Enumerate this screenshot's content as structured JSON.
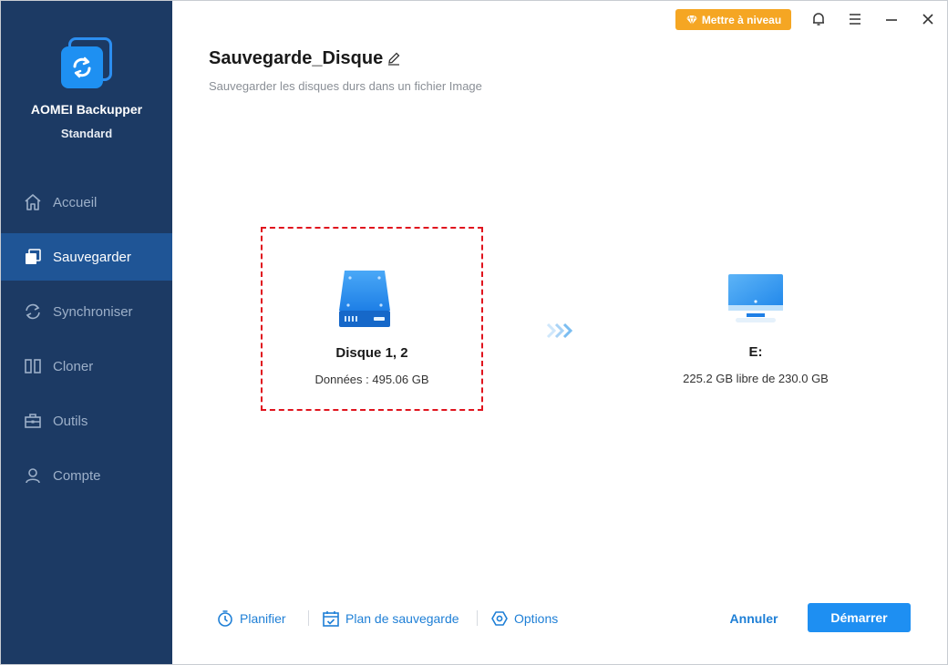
{
  "app": {
    "name": "AOMEI Backupper",
    "edition": "Standard"
  },
  "sidebar": {
    "items": [
      {
        "label": "Accueil",
        "icon": "home-icon",
        "active": false
      },
      {
        "label": "Sauvegarder",
        "icon": "backup-icon",
        "active": true
      },
      {
        "label": "Synchroniser",
        "icon": "sync-icon",
        "active": false
      },
      {
        "label": "Cloner",
        "icon": "clone-icon",
        "active": false
      },
      {
        "label": "Outils",
        "icon": "toolbox-icon",
        "active": false
      },
      {
        "label": "Compte",
        "icon": "user-icon",
        "active": false
      }
    ]
  },
  "topbar": {
    "upgrade_label": "Mettre à niveau",
    "icons": [
      "bell-icon",
      "menu-icon",
      "minimize-icon",
      "close-icon"
    ]
  },
  "header": {
    "title": "Sauvegarde_Disque",
    "subtitle": "Sauvegarder les disques durs dans un fichier Image"
  },
  "source": {
    "name": "Disque 1, 2",
    "info": "Données : 495.06 GB"
  },
  "destination": {
    "name": "E:",
    "info": "225.2 GB libre de 230.0 GB"
  },
  "toolbar": {
    "schedule_label": "Planifier",
    "plan_label": "Plan de sauvegarde",
    "options_label": "Options",
    "cancel_label": "Annuler",
    "start_label": "Démarrer"
  },
  "colors": {
    "sidebar_bg": "#1c3a64",
    "sidebar_active": "#1f5596",
    "accent": "#1e8ff2",
    "upgrade": "#f5a623",
    "selection_border": "#e0141e"
  }
}
